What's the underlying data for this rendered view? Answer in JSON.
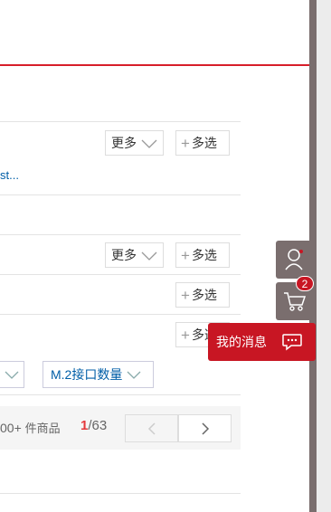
{
  "filters": {
    "more_label": "更多",
    "multi_label": "多选",
    "truncated_link": "st...",
    "m2_filter_label": "M.2接口数量"
  },
  "pager": {
    "count_value": "00+",
    "count_unit": "件商品",
    "current_page": "1",
    "total_pages": "/63"
  },
  "sidebar": {
    "cart_count": "2",
    "message_label": "我的消息"
  },
  "colors": {
    "accent_red": "#d71e2a",
    "sidebar_gray": "#7a6e6e",
    "link_blue": "#005ea7"
  }
}
